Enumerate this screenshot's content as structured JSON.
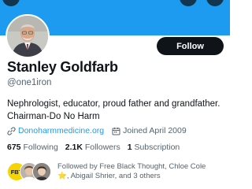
{
  "profile": {
    "name": "Stanley Goldfarb",
    "handle": "@one1iron",
    "bio_line1": "Nephrologist, educator, proud father and grandfather.",
    "bio_line2": "Chairman-Do No Harm",
    "website": "Donoharmmedicine.org",
    "joined": "Joined April 2009",
    "follow_label": "Follow"
  },
  "stats": {
    "following_count": "675",
    "following_label": "Following",
    "followers_count": "2.1K",
    "followers_label": "Followers",
    "subscriptions_count": "1",
    "subscriptions_label": "Subscription"
  },
  "followed_by": {
    "line1": "Followed by Free Black Thought, Chloe Cole",
    "line2": ", Abigail Shrier, and 3 others",
    "first_avatar_text": "FBT"
  },
  "colors": {
    "accent": "#1d9bf0",
    "text_primary": "#0f1419",
    "text_secondary": "#536471",
    "follow_button": "#0f1419"
  },
  "icons": {
    "website": "link-icon",
    "joined": "calendar-icon",
    "emoji": "star-emoji"
  }
}
